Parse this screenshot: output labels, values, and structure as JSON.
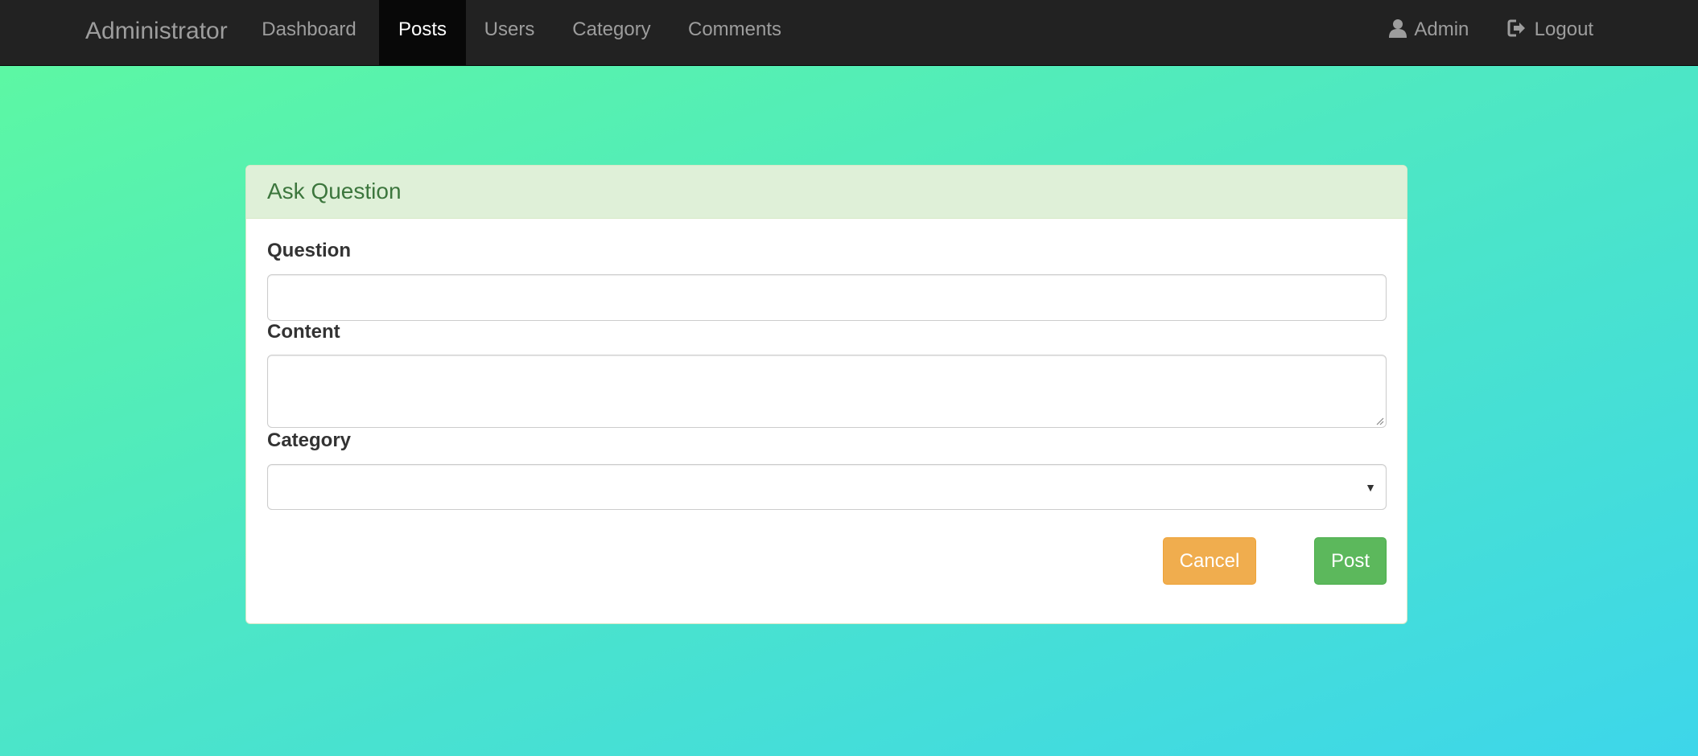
{
  "navbar": {
    "brand": "Administrator",
    "items": [
      {
        "label": "Dashboard",
        "active": false
      },
      {
        "label": "Posts",
        "active": true
      },
      {
        "label": "Users",
        "active": false
      },
      {
        "label": "Category",
        "active": false
      },
      {
        "label": "Comments",
        "active": false
      }
    ],
    "right": {
      "admin_label": "Admin",
      "admin_icon": "user-icon",
      "logout_label": "Logout",
      "logout_icon": "logout-icon"
    }
  },
  "panel": {
    "title": "Ask Question",
    "question": {
      "label": "Question",
      "value": ""
    },
    "content": {
      "label": "Content",
      "value": ""
    },
    "category": {
      "label": "Category",
      "selected": ""
    },
    "buttons": {
      "cancel": "Cancel",
      "post": "Post"
    }
  },
  "colors": {
    "navbar_bg": "#222222",
    "active_tab_bg": "#080808",
    "panel_heading_bg": "#dff0d8",
    "panel_heading_text": "#3c763d",
    "cancel_button": "#f0ad4e",
    "post_button": "#5cb85c",
    "background_gradient_start": "#5ef9a0",
    "background_gradient_end": "#3dd6ea"
  }
}
